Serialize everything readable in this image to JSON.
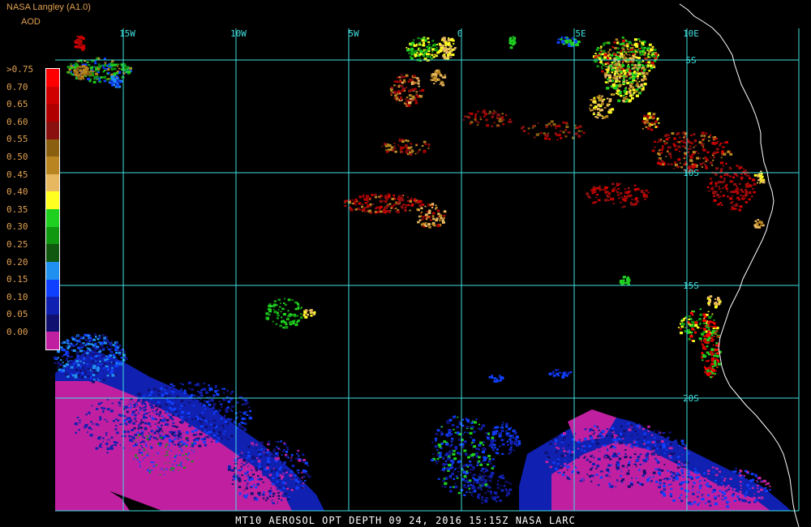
{
  "header": {
    "title": "NASA Langley (A1.0)",
    "subtitle": "AOD",
    "color": "#e0a050"
  },
  "legend": {
    "label_color": "#e0a050",
    "items": [
      {
        "label": ">0.75",
        "color": "#ff0000"
      },
      {
        "label": "0.70",
        "color": "#d00000"
      },
      {
        "label": "0.65",
        "color": "#b00000"
      },
      {
        "label": "0.60",
        "color": "#8a1010"
      },
      {
        "label": "0.55",
        "color": "#8a6010"
      },
      {
        "label": "0.50",
        "color": "#b88520"
      },
      {
        "label": "0.45",
        "color": "#e8b860"
      },
      {
        "label": "0.40",
        "color": "#ffff20"
      },
      {
        "label": "0.35",
        "color": "#20d020"
      },
      {
        "label": "0.30",
        "color": "#109810"
      },
      {
        "label": "0.25",
        "color": "#105810"
      },
      {
        "label": "0.20",
        "color": "#2090f0"
      },
      {
        "label": "0.15",
        "color": "#1040ff"
      },
      {
        "label": "0.10",
        "color": "#1020b0"
      },
      {
        "label": "0.05",
        "color": "#101070"
      },
      {
        "label": "0.00",
        "color": "#c020a0"
      }
    ]
  },
  "map": {
    "grid_color": "#40e0e0",
    "coast_color": "#ffffff",
    "lon_labels": [
      "15W",
      "10W",
      "5W",
      "0",
      "5E",
      "10E"
    ],
    "lat_labels": [
      "5S",
      "10S",
      "15S",
      "20S"
    ]
  },
  "footer": {
    "text": "MT10  AEROSOL OPT DEPTH   09 24, 2016 15:15Z   NASA LARC",
    "color": "#ffffff"
  }
}
